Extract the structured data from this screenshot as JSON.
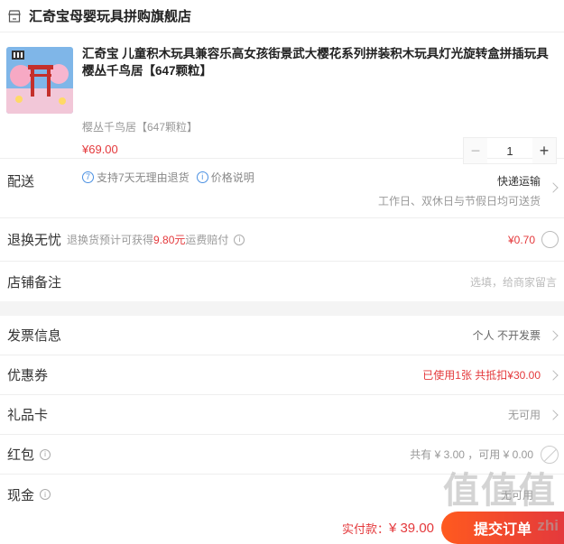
{
  "shop": {
    "name": "汇奇宝母婴玩具拼购旗舰店"
  },
  "product": {
    "title": "汇奇宝 儿童积木玩具兼容乐高女孩街景武大樱花系列拼装积木玩具灯光旋转盒拼插玩具 樱丛千鸟居【647颗粒】",
    "spec": "樱丛千鸟居【647颗粒】",
    "price": "¥69.00",
    "quantity": "1",
    "minus": "−",
    "plus": "+",
    "badge_return_num": "7",
    "badge_return": "支持7天无理由退货",
    "badge_price": "价格说明",
    "badge_price_icon": "i"
  },
  "delivery": {
    "label": "配送",
    "method": "快递运输",
    "time": "工作日、双休日与节假日均可送货"
  },
  "exchange": {
    "label": "退换无忧",
    "desc_prefix": "退换货预计可获得",
    "desc_amount": "9.80元",
    "desc_suffix": "运费赔付",
    "info": "i",
    "fee": "¥0.70"
  },
  "remark": {
    "label": "店铺备注",
    "placeholder": "选填，给商家留言"
  },
  "invoice": {
    "label": "发票信息",
    "value": "个人 不开发票"
  },
  "coupon": {
    "label": "优惠券",
    "value": "已使用1张 共抵扣¥30.00"
  },
  "giftcard": {
    "label": "礼品卡",
    "value": "无可用"
  },
  "redpacket": {
    "label": "红包",
    "info": "i",
    "value": "共有 ¥ 3.00 ，可用 ¥ 0.00"
  },
  "cash": {
    "label": "现金",
    "info": "i",
    "value": "无可用"
  },
  "footer": {
    "total_label": "实付款：",
    "total_value": "¥ 39.00",
    "submit_label": "提交订单"
  },
  "watermark": {
    "text": "值值值",
    "url": "zhi"
  },
  "colors": {
    "accent_red": "#e4393c",
    "accent_orange": "#ff5a1f",
    "info_blue": "#4a90e2"
  },
  "icons": [
    "shop-icon",
    "return-policy-icon",
    "info-icon",
    "chevron-right-icon",
    "radio-icon",
    "disabled-icon"
  ]
}
